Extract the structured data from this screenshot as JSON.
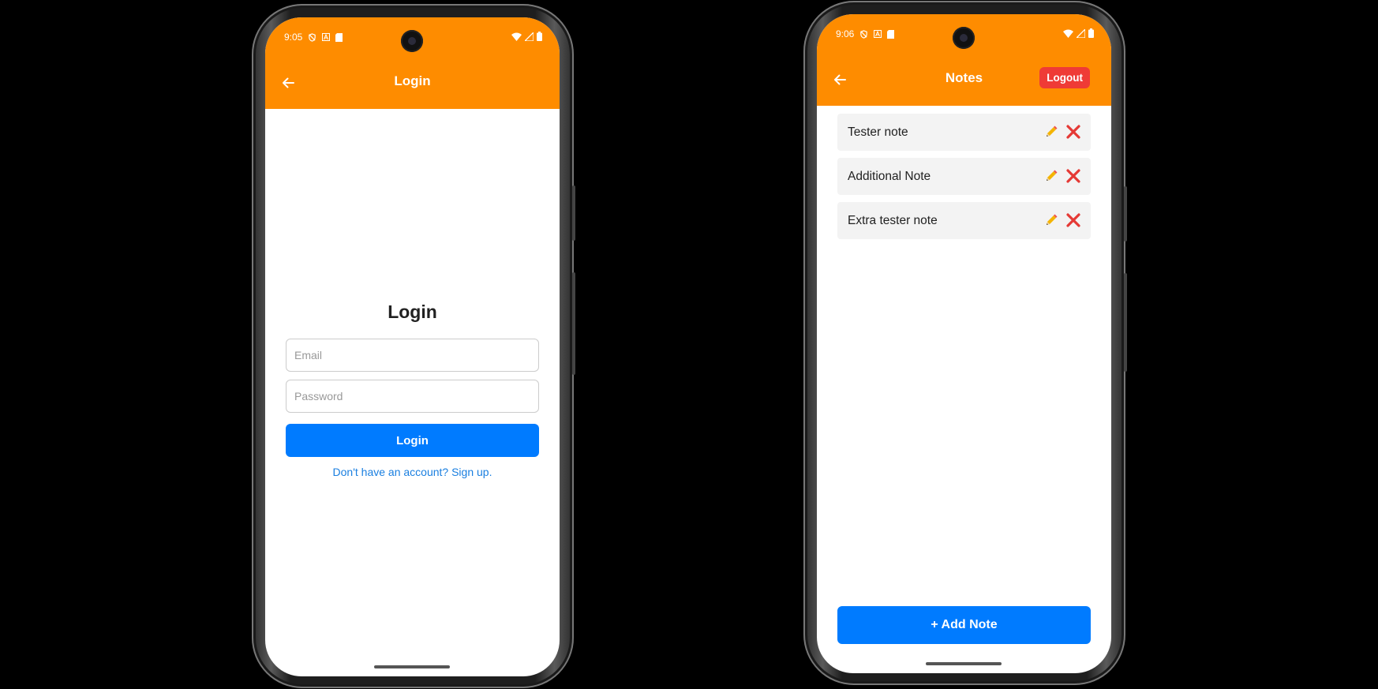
{
  "login_screen": {
    "status": {
      "time": "9:05"
    },
    "appbar": {
      "title": "Login"
    },
    "heading": "Login",
    "email_placeholder": "Email",
    "password_placeholder": "Password",
    "login_button": "Login",
    "signup_link": "Don't have an account? Sign up."
  },
  "notes_screen": {
    "status": {
      "time": "9:06"
    },
    "appbar": {
      "title": "Notes",
      "logout_label": "Logout"
    },
    "notes": [
      {
        "text": "Tester note"
      },
      {
        "text": "Additional Note"
      },
      {
        "text": "Extra tester note"
      }
    ],
    "add_note_button": "+ Add Note"
  },
  "icons": {
    "back": "arrow-left-icon",
    "edit": "pencil-icon",
    "delete": "red-x-icon"
  },
  "colors": {
    "header": "#fe8c00",
    "primary": "#007bff",
    "logout": "#ef3b36",
    "delete_icon": "#e53935",
    "link": "#1a7fe0"
  }
}
